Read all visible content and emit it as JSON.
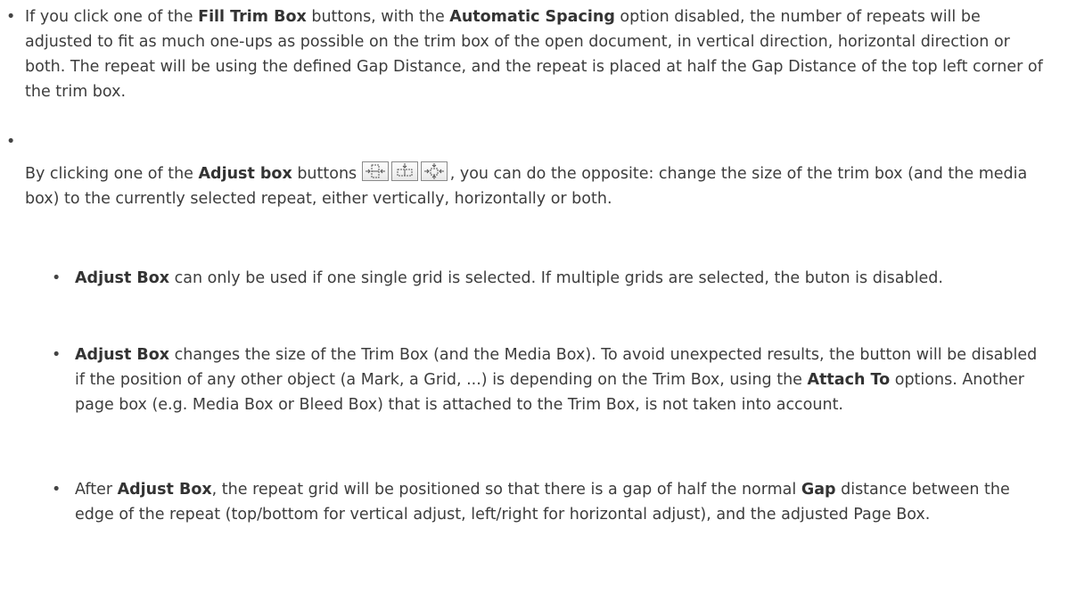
{
  "bullets": [
    {
      "parts": [
        "If you click one of the ",
        "Fill Trim Box",
        " buttons, with the ",
        "Automatic Spacing",
        " option disabled, the number of repeats will be adjusted to fit as much one-ups as possible on the trim box of the open document, in vertical direction, horizontal direction or both. The repeat will be using the defined Gap Distance, and the repeat is placed at half the Gap Distance of the top left corner of the trim box."
      ]
    },
    {
      "parts": [
        "By clicking one of the ",
        "Adjust box",
        " buttons ",
        ", you can do the opposite: change the size of the trim box (and the media box) to the currently selected repeat, either vertically, horizontally or both."
      ],
      "icons": [
        "adjust-vertical-icon",
        "adjust-horizontal-icon",
        "adjust-both-icon"
      ]
    }
  ],
  "subbullets": [
    {
      "parts": [
        "Adjust Box",
        " can only be used if one single grid is selected. If multiple grids are selected, the buton is disabled."
      ]
    },
    {
      "parts": [
        "Adjust Box",
        " changes the size of the Trim Box (and the Media Box). To avoid unexpected results, the button will be disabled if the position of any other object (a Mark, a Grid, ...) is depending on the Trim Box, using the ",
        "Attach To",
        " options. Another page box (e.g. Media Box or Bleed Box) that is attached to the Trim Box, is not taken into account."
      ]
    },
    {
      "parts": [
        "After ",
        "Adjust Box",
        ", the repeat grid will be positioned so that there is a gap of half the normal ",
        "Gap",
        " distance between the edge of the repeat (top/bottom for vertical adjust, left/right for horizontal adjust), and the adjusted Page Box."
      ]
    }
  ],
  "bullet_char": "•"
}
